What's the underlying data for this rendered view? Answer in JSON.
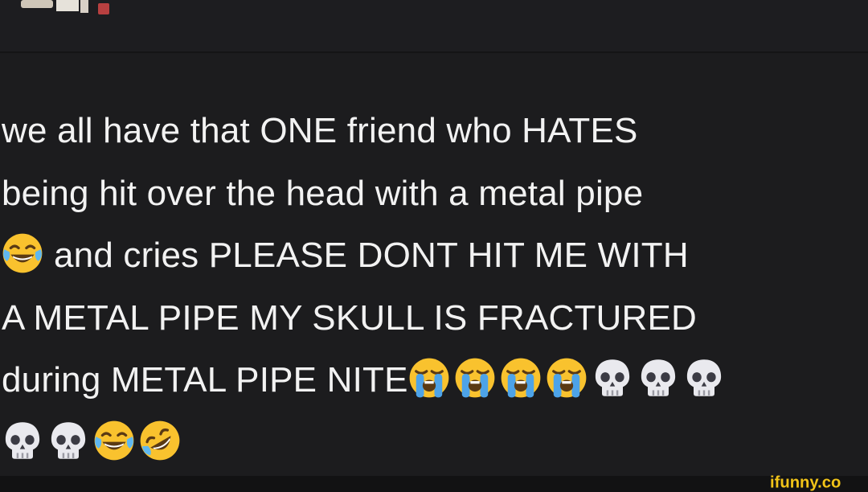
{
  "post": {
    "lines": [
      "we all have that ONE friend who HATES",
      "being hit over the head with a metal pipe",
      "and cries PLEASE DONT HIT ME WITH",
      "A METAL PIPE MY SKULL IS FRACTURED",
      "during METAL PIPE NITE"
    ]
  },
  "emojis": {
    "line3_lead": "face-with-tears-of-joy-icon",
    "line5_tail": [
      "loudly-crying-face-icon",
      "loudly-crying-face-icon",
      "loudly-crying-face-icon",
      "loudly-crying-face-icon",
      "skull-icon",
      "skull-icon",
      "skull-icon"
    ],
    "line6": [
      "skull-icon",
      "skull-icon",
      "face-with-tears-of-joy-icon",
      "rolling-on-the-floor-laughing-icon"
    ]
  },
  "watermark": {
    "text": "ifunny.co",
    "color": "#f2c418"
  },
  "colors": {
    "background": "#1c1c1e",
    "text": "#f2f2f2"
  }
}
